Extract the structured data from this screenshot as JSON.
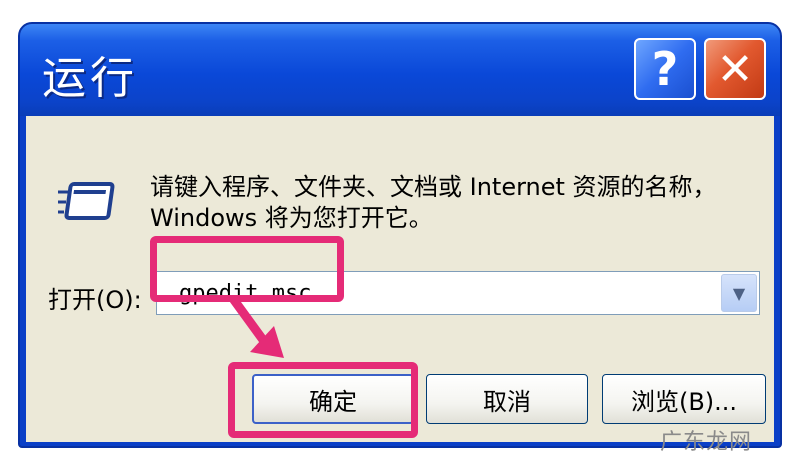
{
  "window": {
    "title": "运行",
    "help_label": "?",
    "close_label": "✕"
  },
  "dialog": {
    "description": "请键入程序、文件夹、文档或 Internet 资源的名称，Windows 将为您打开它。",
    "open_label": "打开(O):",
    "input_value": "gpedit.msc",
    "dropdown_icon": "chevron-down-icon"
  },
  "buttons": {
    "ok": "确定",
    "cancel": "取消",
    "browse": "浏览(B)..."
  },
  "annotation": {
    "highlight_color": "#e52b77"
  },
  "watermark": {
    "text": "广东龙网"
  }
}
